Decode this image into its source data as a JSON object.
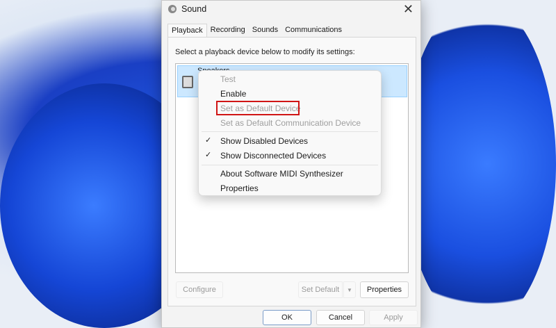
{
  "window": {
    "title": "Sound",
    "close_icon": "close-icon"
  },
  "tabs": [
    "Playback",
    "Recording",
    "Sounds",
    "Communications"
  ],
  "hint": "Select a playback device below to modify its settings:",
  "device": {
    "name": "Speakers"
  },
  "context_menu": {
    "items": [
      {
        "label": "Test",
        "disabled": true
      },
      {
        "label": "Enable",
        "disabled": false
      },
      {
        "label": "Set as Default Device",
        "disabled": true,
        "highlighted": true
      },
      {
        "label": "Set as Default Communication Device",
        "disabled": true
      },
      {
        "label": "Show Disabled Devices",
        "checked": true
      },
      {
        "label": "Show Disconnected Devices",
        "checked": true
      },
      {
        "label": "About Software MIDI Synthesizer"
      },
      {
        "label": "Properties"
      }
    ],
    "check": "✓"
  },
  "buttons": {
    "configure": "Configure",
    "set_default": "Set Default",
    "properties": "Properties",
    "ok": "OK",
    "cancel": "Cancel",
    "apply": "Apply"
  },
  "colors": {
    "highlight_box": "#d01515",
    "selection": "#cce8ff"
  }
}
